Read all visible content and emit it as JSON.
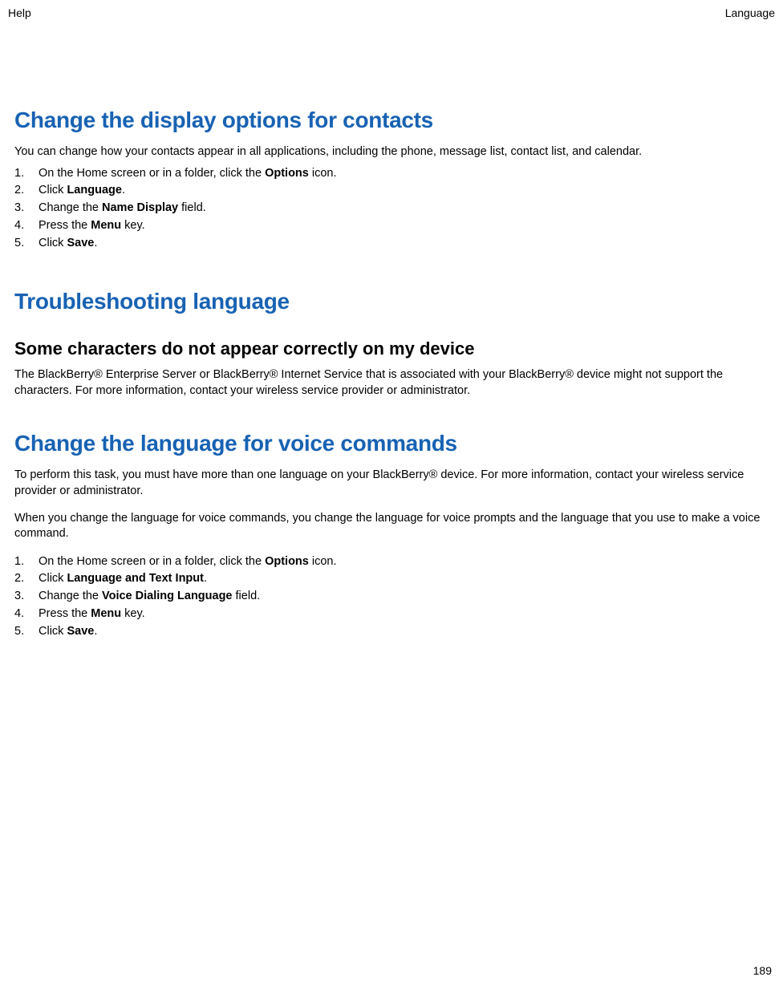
{
  "header": {
    "left": "Help",
    "right": "Language"
  },
  "section1": {
    "title": "Change the display options for contacts",
    "intro": "You can change how your contacts appear in all applications, including the phone, message list, contact list, and calendar.",
    "steps": [
      {
        "pre": "On the Home screen or in a folder, click the ",
        "bold": "Options",
        "post": " icon."
      },
      {
        "pre": "Click ",
        "bold": "Language",
        "post": "."
      },
      {
        "pre": "Change the ",
        "bold": "Name Display",
        "post": " field."
      },
      {
        "pre": "Press the ",
        "bold": "Menu",
        "post": " key."
      },
      {
        "pre": "Click ",
        "bold": "Save",
        "post": "."
      }
    ]
  },
  "section2": {
    "title": "Troubleshooting language",
    "sub": {
      "title": "Some characters do not appear correctly on my device",
      "body": "The BlackBerry® Enterprise Server or BlackBerry® Internet Service that is associated with your BlackBerry® device might not support the characters. For more information, contact your wireless service provider or administrator."
    }
  },
  "section3": {
    "title": "Change the language for voice commands",
    "intro1": "To perform this task, you must have more than one language on your BlackBerry® device. For more information, contact your wireless service provider or administrator.",
    "intro2": "When you change the language for voice commands, you change the language for voice prompts and the language that you use to make a voice command.",
    "steps": [
      {
        "pre": "On the Home screen or in a folder, click the ",
        "bold": "Options",
        "post": " icon."
      },
      {
        "pre": "Click ",
        "bold": "Language and Text Input",
        "post": "."
      },
      {
        "pre": "Change the ",
        "bold": "Voice Dialing Language",
        "post": " field."
      },
      {
        "pre": "Press the ",
        "bold": "Menu",
        "post": " key."
      },
      {
        "pre": "Click ",
        "bold": "Save",
        "post": "."
      }
    ]
  },
  "page_number": "189"
}
